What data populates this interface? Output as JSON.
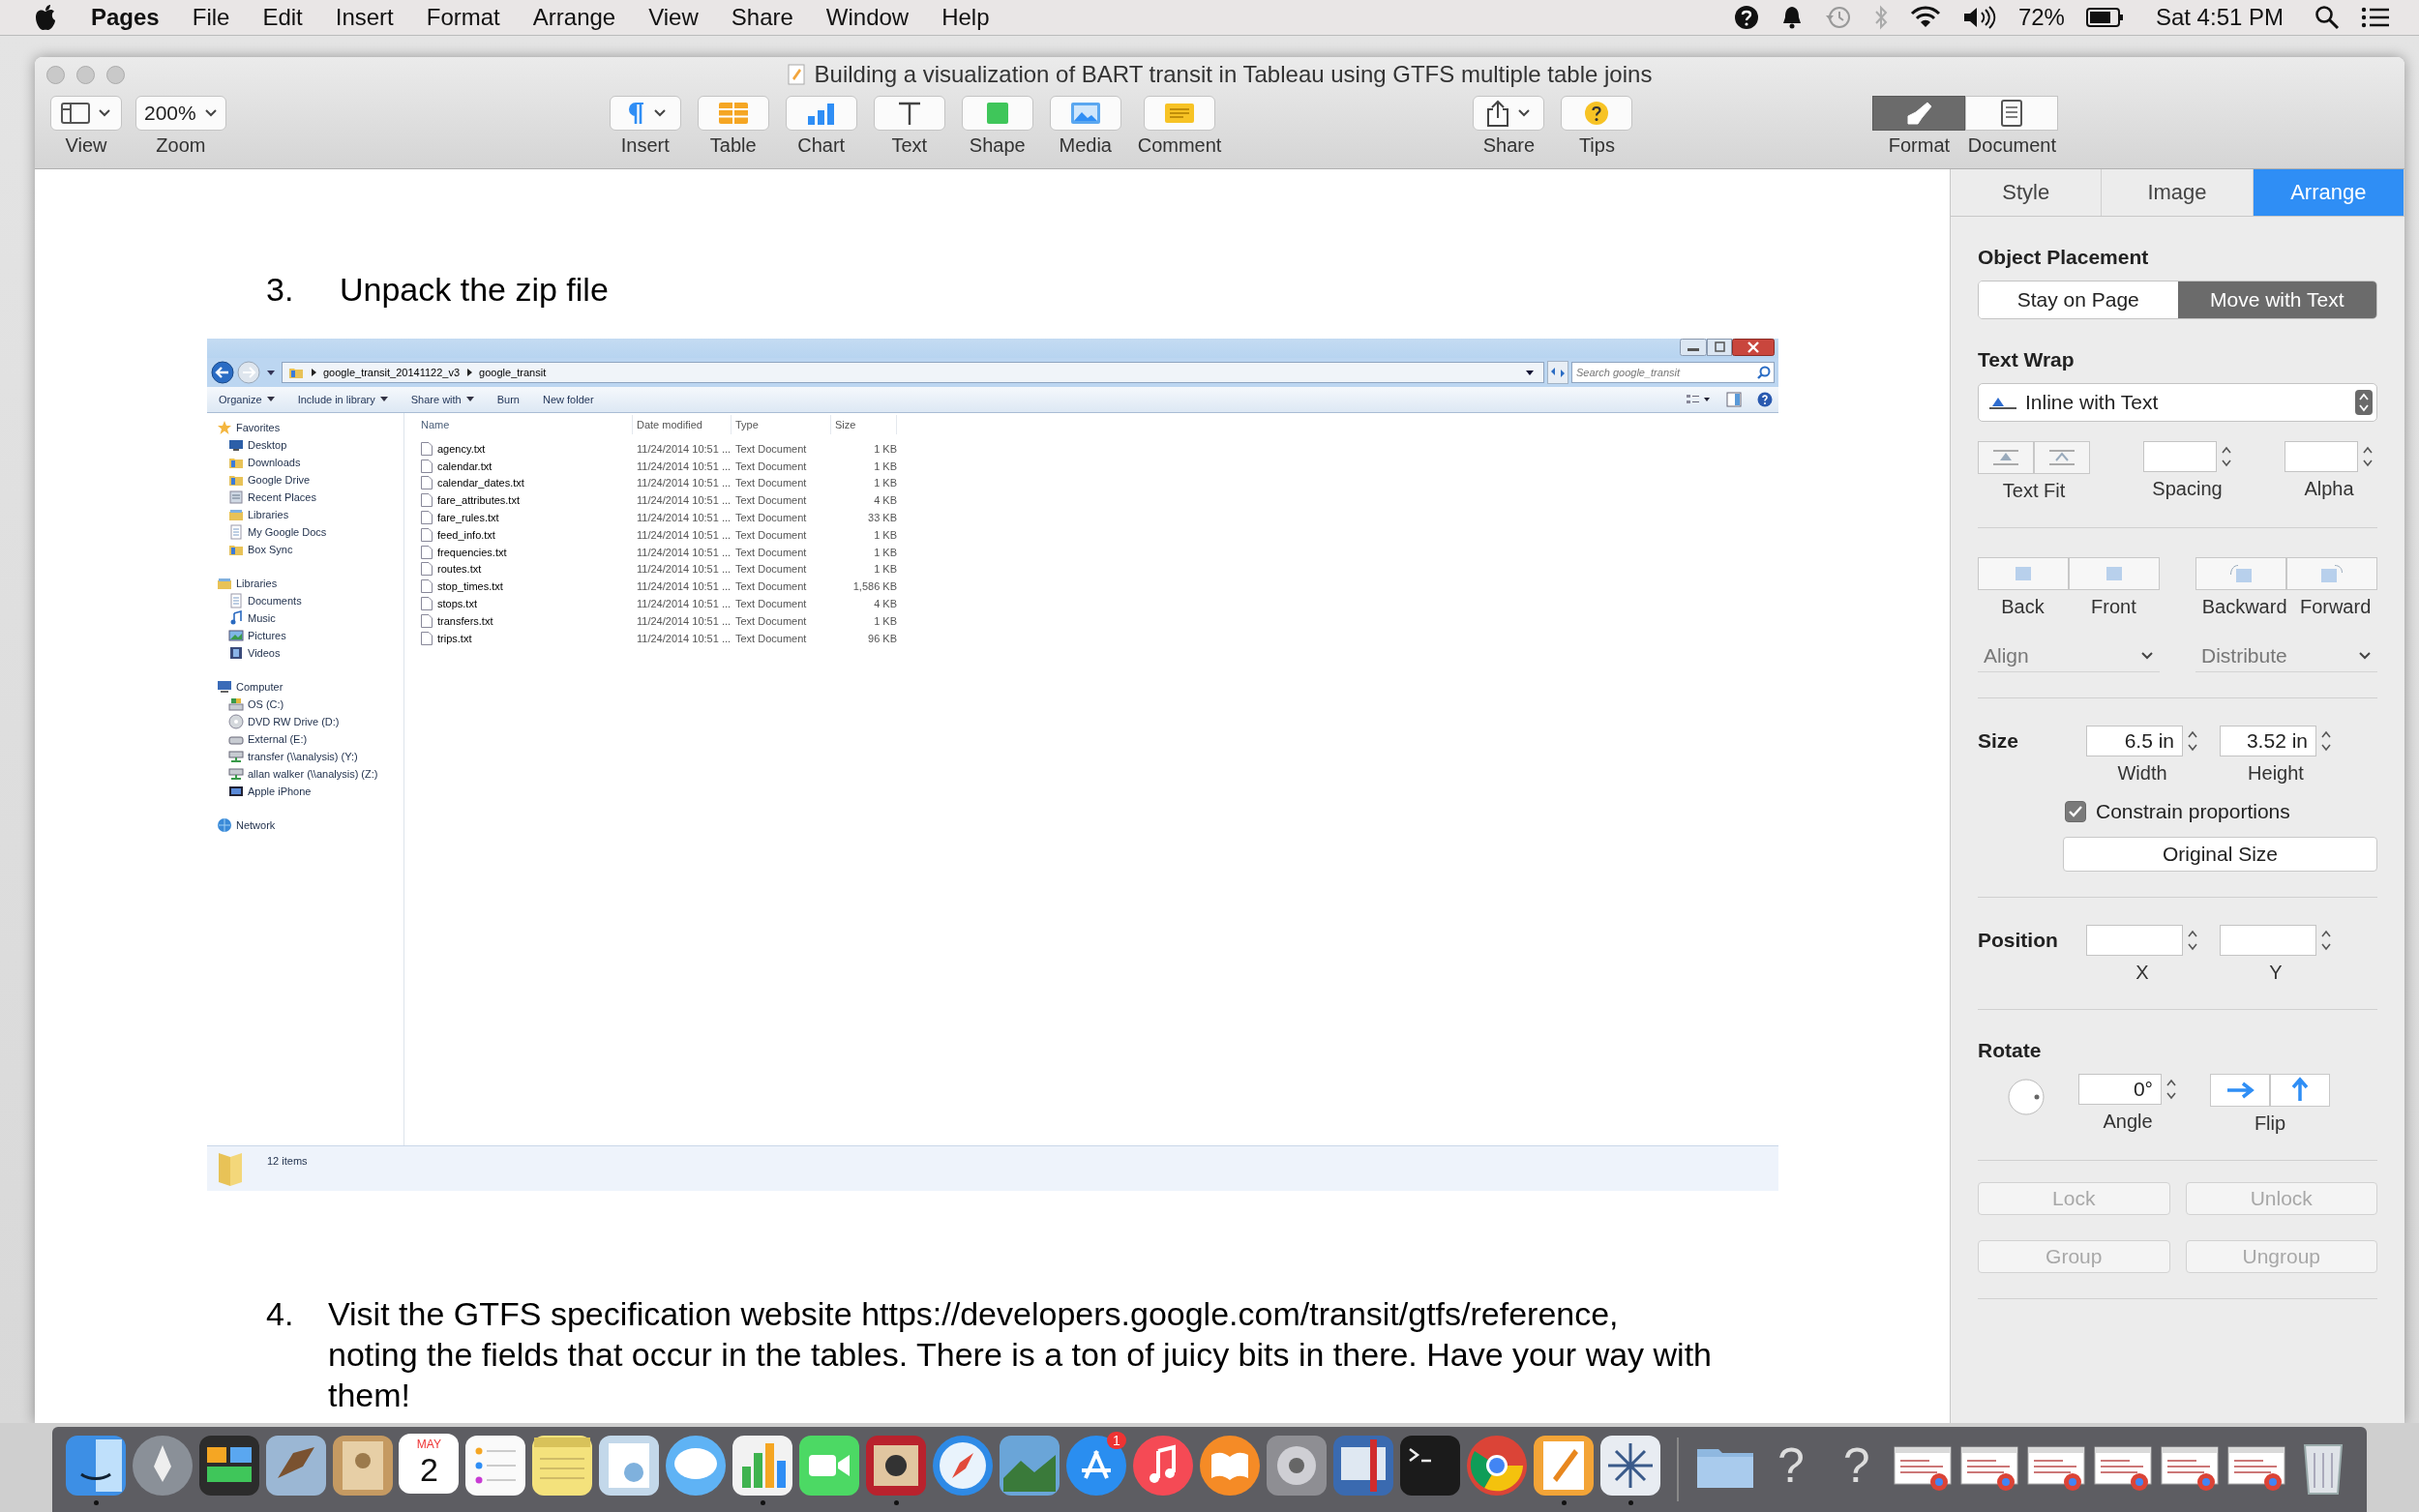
{
  "menubar": {
    "app": "Pages",
    "menus": [
      "File",
      "Edit",
      "Insert",
      "Format",
      "Arrange",
      "View",
      "Share",
      "Window",
      "Help"
    ],
    "battery": "72%",
    "clock": "Sat 4:51 PM"
  },
  "window": {
    "title": "Building a visualization of BART transit in Tableau using GTFS multiple table joins"
  },
  "toolbar": {
    "left": [
      {
        "kind": "view",
        "label": "View"
      },
      {
        "kind": "zoom",
        "value": "200%",
        "label": "Zoom"
      }
    ],
    "center": [
      {
        "kind": "insert",
        "label": "Insert"
      },
      {
        "kind": "table",
        "label": "Table"
      },
      {
        "kind": "chart",
        "label": "Chart"
      },
      {
        "kind": "text",
        "label": "Text"
      },
      {
        "kind": "shape",
        "label": "Shape"
      },
      {
        "kind": "media",
        "label": "Media"
      },
      {
        "kind": "comment",
        "label": "Comment"
      }
    ],
    "right": [
      {
        "kind": "share",
        "label": "Share"
      },
      {
        "kind": "tips",
        "label": "Tips"
      }
    ],
    "panels": [
      {
        "kind": "format",
        "label": "Format",
        "selected": true
      },
      {
        "kind": "document",
        "label": "Document",
        "selected": false
      }
    ]
  },
  "document": {
    "blocks": [
      {
        "kind": "step",
        "number": "3.",
        "text": "Unpack the zip file"
      },
      {
        "kind": "screenshot",
        "explorer": {
          "path": [
            "google_transit_20141122_v3",
            "google_transit"
          ],
          "search": {
            "placeholder": "Search google_transit"
          },
          "commands": [
            {
              "label": "Organize",
              "menu": true
            },
            {
              "label": "Include in library",
              "menu": true
            },
            {
              "label": "Share with",
              "menu": true
            },
            {
              "label": "Burn",
              "menu": false
            },
            {
              "label": "New folder",
              "menu": false
            }
          ],
          "nav": [
            {
              "label": "Favorites",
              "kind": "star",
              "children": [
                {
                  "label": "Desktop",
                  "kind": "desktop"
                },
                {
                  "label": "Downloads",
                  "kind": "folder"
                },
                {
                  "label": "Google Drive",
                  "kind": "folder"
                },
                {
                  "label": "Recent Places",
                  "kind": "places"
                },
                {
                  "label": "Libraries",
                  "kind": "library"
                },
                {
                  "label": "My Google Docs",
                  "kind": "doc"
                },
                {
                  "label": "Box Sync",
                  "kind": "folder"
                }
              ]
            },
            {
              "label": "Libraries",
              "kind": "library",
              "children": [
                {
                  "label": "Documents",
                  "kind": "doc"
                },
                {
                  "label": "Music",
                  "kind": "music"
                },
                {
                  "label": "Pictures",
                  "kind": "pictures"
                },
                {
                  "label": "Videos",
                  "kind": "videos"
                }
              ]
            },
            {
              "label": "Computer",
              "kind": "computer",
              "children": [
                {
                  "label": "OS (C:)",
                  "kind": "drive"
                },
                {
                  "label": "DVD RW Drive (D:)",
                  "kind": "dvd"
                },
                {
                  "label": "External (E:)",
                  "kind": "external"
                },
                {
                  "label": "transfer (\\\\analysis) (Y:)",
                  "kind": "netdrive"
                },
                {
                  "label": "allan walker (\\\\analysis) (Z:)",
                  "kind": "netdrive"
                },
                {
                  "label": "Apple iPhone",
                  "kind": "phone"
                }
              ]
            },
            {
              "label": "Network",
              "kind": "network"
            }
          ],
          "columns": [
            "Name",
            "Date modified",
            "Type",
            "Size"
          ],
          "rows": [
            {
              "name": "agency.txt",
              "modified": "11/24/2014 10:51 ...",
              "type": "Text Document",
              "size": "1 KB"
            },
            {
              "name": "calendar.txt",
              "modified": "11/24/2014 10:51 ...",
              "type": "Text Document",
              "size": "1 KB"
            },
            {
              "name": "calendar_dates.txt",
              "modified": "11/24/2014 10:51 ...",
              "type": "Text Document",
              "size": "1 KB"
            },
            {
              "name": "fare_attributes.txt",
              "modified": "11/24/2014 10:51 ...",
              "type": "Text Document",
              "size": "4 KB"
            },
            {
              "name": "fare_rules.txt",
              "modified": "11/24/2014 10:51 ...",
              "type": "Text Document",
              "size": "33 KB"
            },
            {
              "name": "feed_info.txt",
              "modified": "11/24/2014 10:51 ...",
              "type": "Text Document",
              "size": "1 KB"
            },
            {
              "name": "frequencies.txt",
              "modified": "11/24/2014 10:51 ...",
              "type": "Text Document",
              "size": "1 KB"
            },
            {
              "name": "routes.txt",
              "modified": "11/24/2014 10:51 ...",
              "type": "Text Document",
              "size": "1 KB"
            },
            {
              "name": "stop_times.txt",
              "modified": "11/24/2014 10:51 ...",
              "type": "Text Document",
              "size": "1,586 KB"
            },
            {
              "name": "stops.txt",
              "modified": "11/24/2014 10:51 ...",
              "type": "Text Document",
              "size": "4 KB"
            },
            {
              "name": "transfers.txt",
              "modified": "11/24/2014 10:51 ...",
              "type": "Text Document",
              "size": "1 KB"
            },
            {
              "name": "trips.txt",
              "modified": "11/24/2014 10:51 ...",
              "type": "Text Document",
              "size": "96 KB"
            }
          ],
          "status": "12 items"
        }
      },
      {
        "kind": "step",
        "number": "4.",
        "text": "Visit the GTFS specification website https://developers.google.com/transit/gtfs/reference, noting the fields that occur in the tables.  There is a ton of juicy bits in there.  Have your way with them!"
      }
    ]
  },
  "inspector": {
    "tabs": [
      {
        "label": "Style",
        "selected": false
      },
      {
        "label": "Image",
        "selected": false
      },
      {
        "label": "Arrange",
        "selected": true
      }
    ],
    "placement": {
      "title": "Object Placement",
      "options": [
        {
          "label": "Stay on Page",
          "selected": false
        },
        {
          "label": "Move with Text",
          "selected": true
        }
      ]
    },
    "wrap": {
      "title": "Text Wrap",
      "value": "Inline with Text",
      "text_fit": "Text Fit",
      "spacing": "Spacing",
      "alpha": "Alpha"
    },
    "order": [
      {
        "label": "Back"
      },
      {
        "label": "Front"
      },
      {
        "label": "Backward"
      },
      {
        "label": "Forward"
      }
    ],
    "align": "Align",
    "distribute": "Distribute",
    "size": {
      "title": "Size",
      "width": "6.5 in",
      "height": "3.52 in",
      "width_label": "Width",
      "height_label": "Height",
      "constrain": {
        "label": "Constrain proportions",
        "checked": true
      },
      "original": "Original Size"
    },
    "position": {
      "title": "Position",
      "x_label": "X",
      "y_label": "Y"
    },
    "rotate": {
      "title": "Rotate",
      "angle": "0°",
      "angle_label": "Angle",
      "flip_label": "Flip"
    },
    "locks": [
      {
        "label": "Lock",
        "disabled": true
      },
      {
        "label": "Unlock",
        "disabled": true
      },
      {
        "label": "Group",
        "disabled": true
      },
      {
        "label": "Ungroup",
        "disabled": true
      }
    ]
  },
  "dock": {
    "items": [
      {
        "kind": "finder",
        "running": true
      },
      {
        "kind": "launchpad",
        "running": false
      },
      {
        "kind": "monitor",
        "running": false
      },
      {
        "kind": "stamp",
        "running": false
      },
      {
        "kind": "contacts",
        "running": false
      },
      {
        "kind": "calendar",
        "month": "MAY",
        "day": "2",
        "running": false
      },
      {
        "kind": "reminders",
        "running": false
      },
      {
        "kind": "notes",
        "running": false
      },
      {
        "kind": "preview",
        "running": false
      },
      {
        "kind": "messages",
        "running": false
      },
      {
        "kind": "numbers",
        "running": true
      },
      {
        "kind": "facetime",
        "running": false
      },
      {
        "kind": "photobooth",
        "running": true
      },
      {
        "kind": "safari",
        "running": false
      },
      {
        "kind": "iphoto",
        "running": false
      },
      {
        "kind": "appstore",
        "badge": "1",
        "running": false
      },
      {
        "kind": "itunes",
        "running": false
      },
      {
        "kind": "ibooks",
        "running": false
      },
      {
        "kind": "prefs",
        "running": false
      },
      {
        "kind": "screens",
        "running": false
      },
      {
        "kind": "terminal",
        "running": false
      },
      {
        "kind": "chrome",
        "running": false
      },
      {
        "kind": "pages",
        "running": true
      },
      {
        "kind": "tableau",
        "running": true
      },
      {
        "kind": "separator"
      },
      {
        "kind": "folder"
      },
      {
        "kind": "unknown",
        "glyph": "?"
      },
      {
        "kind": "unknown",
        "glyph": "?"
      },
      {
        "kind": "thumb"
      },
      {
        "kind": "thumb"
      },
      {
        "kind": "thumb"
      },
      {
        "kind": "thumb"
      },
      {
        "kind": "thumb"
      },
      {
        "kind": "thumb"
      },
      {
        "kind": "trash"
      }
    ]
  }
}
